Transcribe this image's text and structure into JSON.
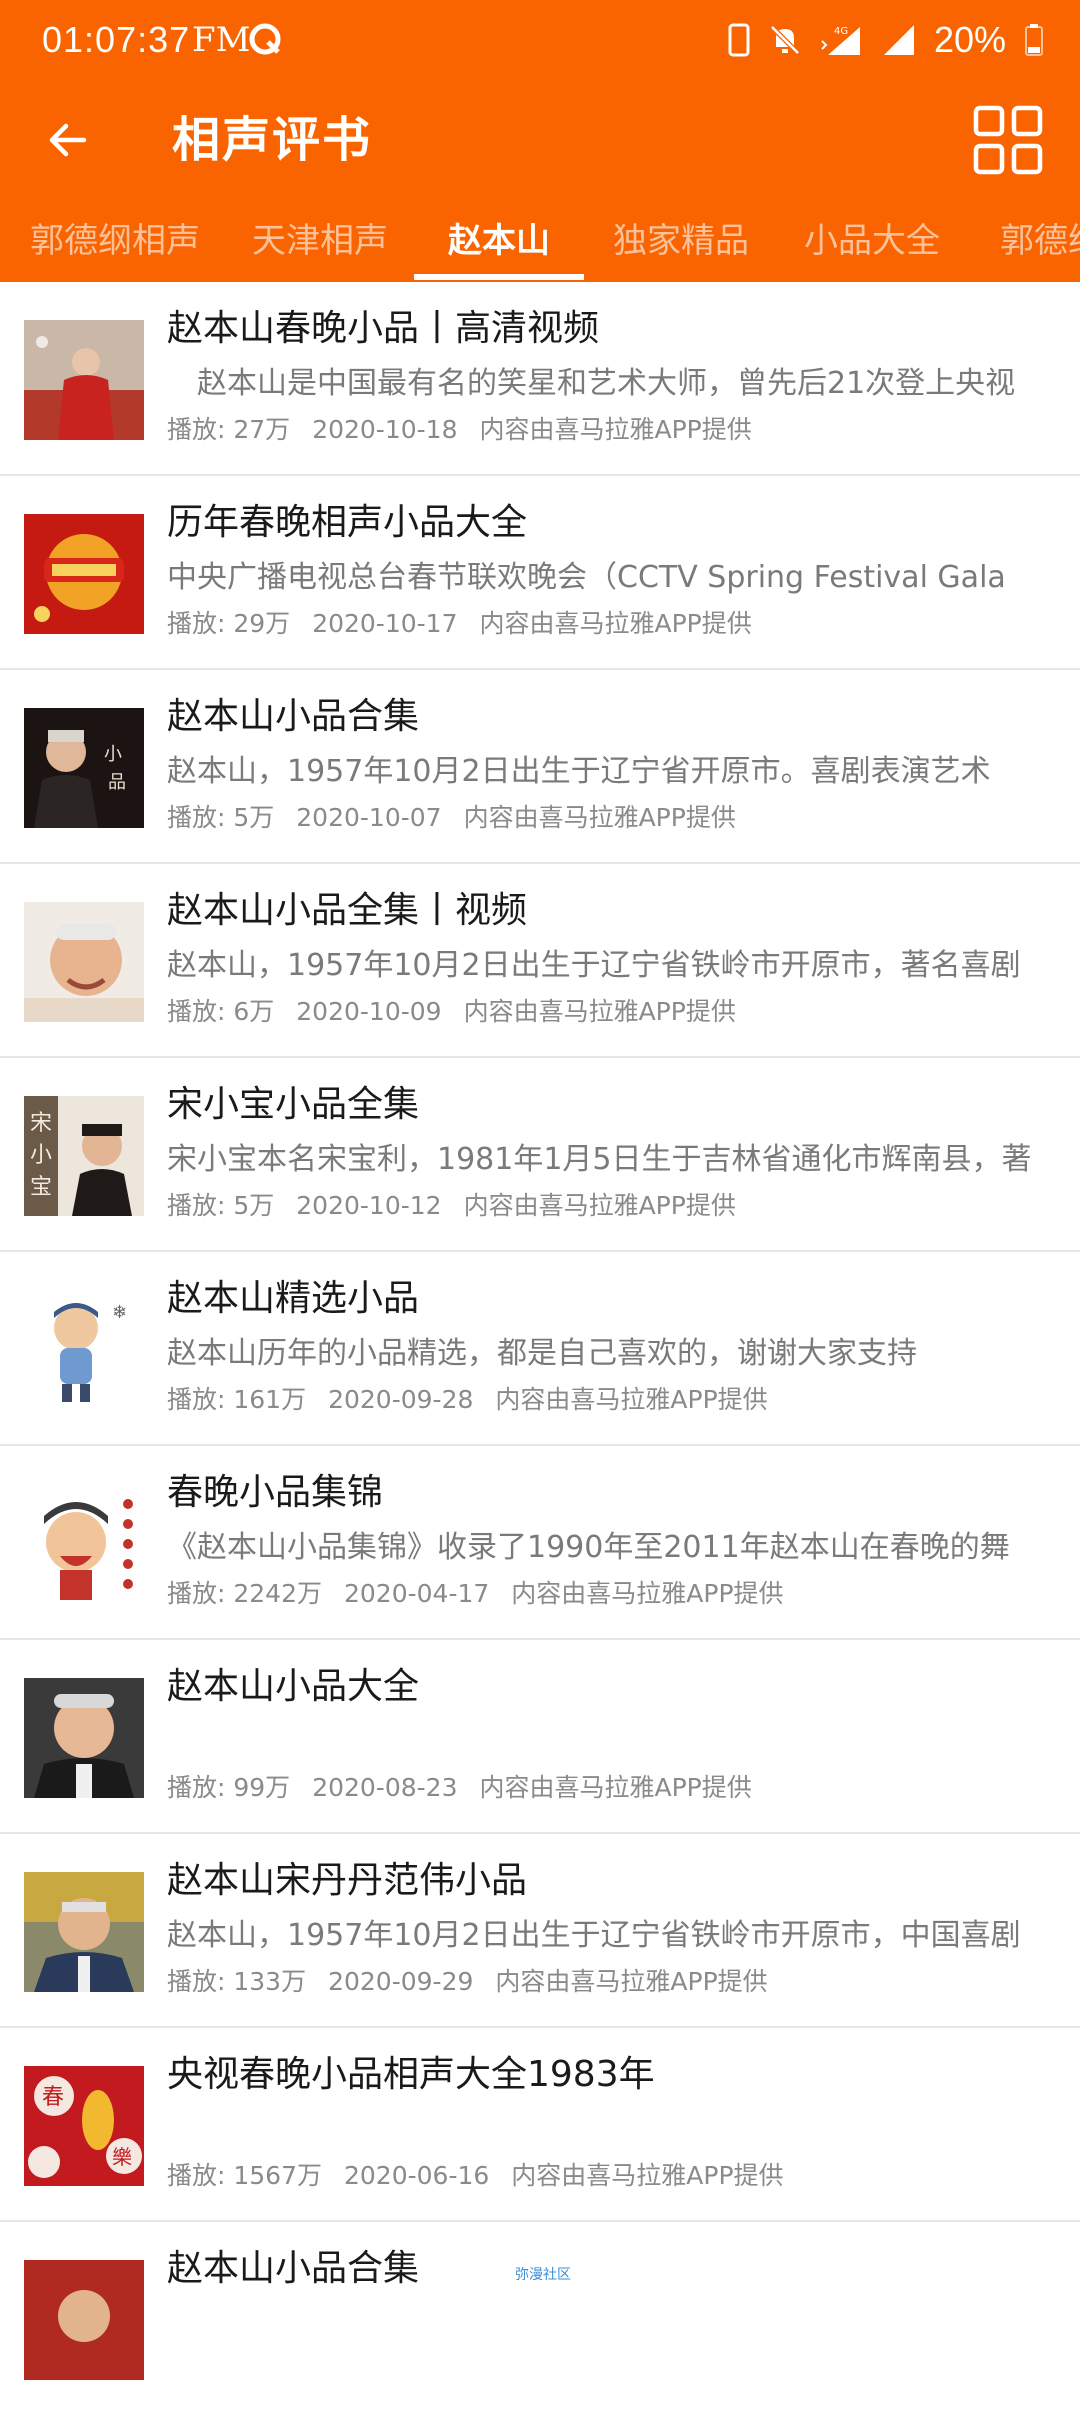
{
  "status_bar": {
    "time": "01:07:37",
    "fm": "FM",
    "battery_text": "20%",
    "network": "4G"
  },
  "toolbar": {
    "title": "相声评书"
  },
  "tabs": [
    {
      "label": "郭德纲相声"
    },
    {
      "label": "天津相声"
    },
    {
      "label": "赵本山"
    },
    {
      "label": "独家精品"
    },
    {
      "label": "小品大全"
    },
    {
      "label": "郭德纲"
    }
  ],
  "active_tab": "赵本山",
  "colors": {
    "brand": "#fa6400",
    "title": "#1a1a1a",
    "desc": "#7a7a7a",
    "meta": "#8a8a8a"
  },
  "items": [
    {
      "title": "赵本山春晚小品丨高清视频",
      "desc": "　赵本山是中国最有名的笑星和艺术大师，曾先后21次登上央视",
      "plays": "播放: 27万",
      "date": "2020-10-18",
      "source": "内容由喜马拉雅APP提供"
    },
    {
      "title": "历年春晚相声小品大全",
      "desc": "中央广播电视总台春节联欢晚会（CCTV Spring Festival Gala",
      "plays": "播放: 29万",
      "date": "2020-10-17",
      "source": "内容由喜马拉雅APP提供"
    },
    {
      "title": "赵本山小品合集",
      "desc": "赵本山，1957年10月2日出生于辽宁省开原市。喜剧表演艺术",
      "plays": "播放: 5万",
      "date": "2020-10-07",
      "source": "内容由喜马拉雅APP提供"
    },
    {
      "title": "赵本山小品全集丨视频",
      "desc": "赵本山，1957年10月2日出生于辽宁省铁岭市开原市，著名喜剧",
      "plays": "播放: 6万",
      "date": "2020-10-09",
      "source": "内容由喜马拉雅APP提供"
    },
    {
      "title": "宋小宝小品全集",
      "desc": "宋小宝本名宋宝利，1981年1月5日生于吉林省通化市辉南县，著",
      "plays": "播放: 5万",
      "date": "2020-10-12",
      "source": "内容由喜马拉雅APP提供"
    },
    {
      "title": "赵本山精选小品",
      "desc": "赵本山历年的小品精选，都是自己喜欢的，谢谢大家支持",
      "plays": "播放: 161万",
      "date": "2020-09-28",
      "source": "内容由喜马拉雅APP提供"
    },
    {
      "title": "春晚小品集锦",
      "desc": "《赵本山小品集锦》收录了1990年至2011年赵本山在春晚的舞",
      "plays": "播放: 2242万",
      "date": "2020-04-17",
      "source": "内容由喜马拉雅APP提供"
    },
    {
      "title": "赵本山小品大全",
      "desc": "",
      "plays": "播放: 99万",
      "date": "2020-08-23",
      "source": "内容由喜马拉雅APP提供"
    },
    {
      "title": "赵本山宋丹丹范伟小品",
      "desc": "赵本山，1957年10月2日出生于辽宁省铁岭市开原市，中国喜剧",
      "plays": "播放: 133万",
      "date": "2020-09-29",
      "source": "内容由喜马拉雅APP提供"
    },
    {
      "title": "央视春晚小品相声大全1983年",
      "desc": "",
      "plays": "播放: 1567万",
      "date": "2020-06-16",
      "source": "内容由喜马拉雅APP提供"
    },
    {
      "title": "赵本山小品合集",
      "desc": "",
      "plays": "",
      "date": "",
      "source": ""
    }
  ],
  "floating_tag": "弥漫社区"
}
